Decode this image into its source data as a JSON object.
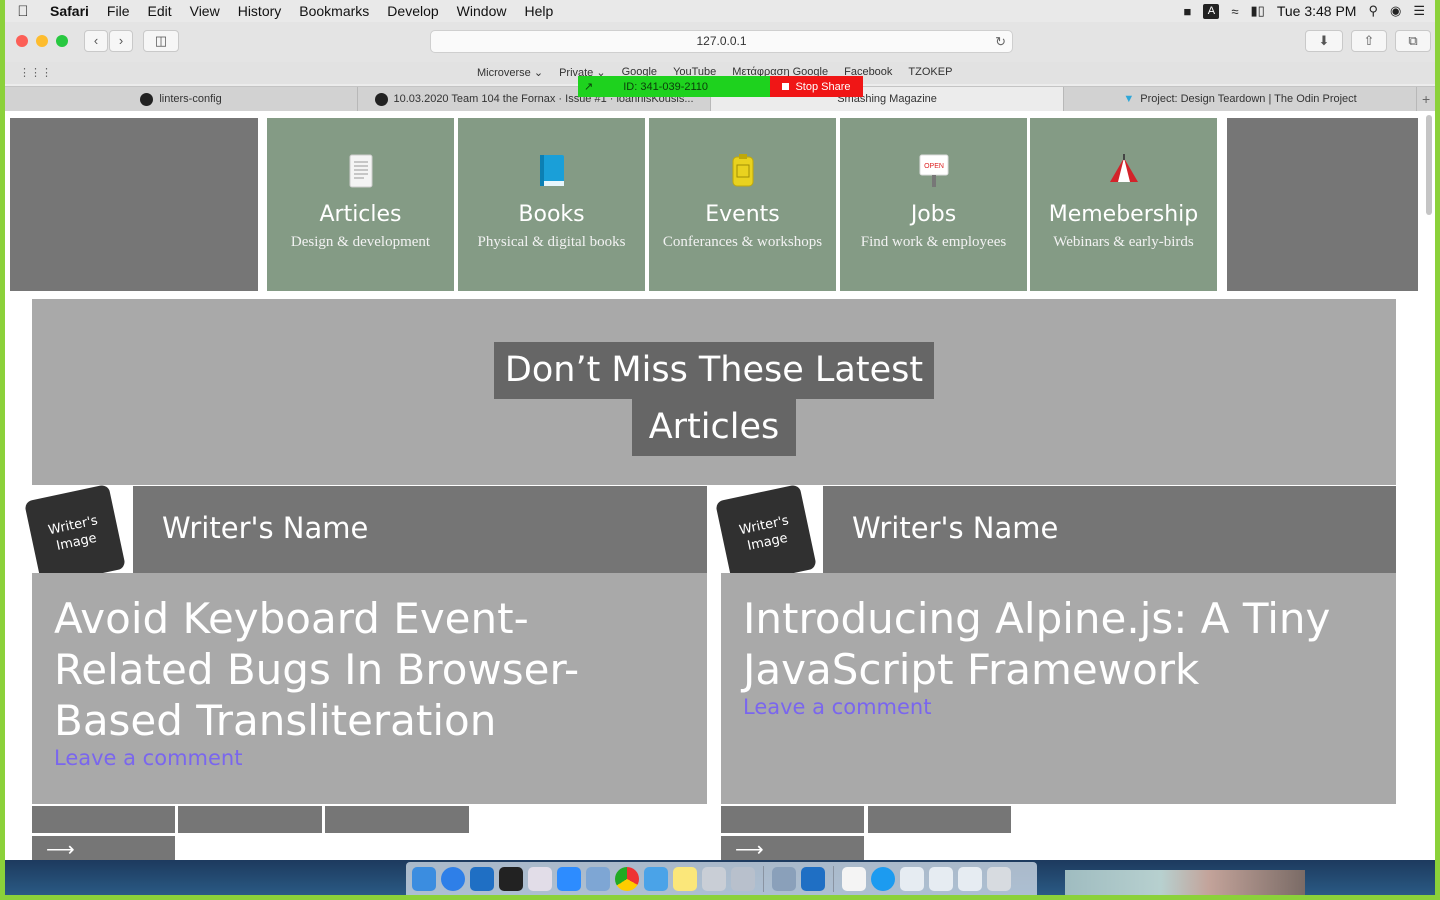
{
  "menubar": {
    "app": "Safari",
    "items": [
      "File",
      "Edit",
      "View",
      "History",
      "Bookmarks",
      "Develop",
      "Window",
      "Help"
    ],
    "input_source": "A",
    "clock": "Tue 3:48 PM"
  },
  "toolbar": {
    "address": "127.0.0.1"
  },
  "favorites": [
    "Microverse ⌄",
    "Private ⌄",
    "Google",
    "YouTube",
    "Μετάφραση Google",
    "Facebook",
    "TZOKEP"
  ],
  "share": {
    "id": "ID: 341-039-2110",
    "stop": "Stop Share"
  },
  "tabs": [
    {
      "label": "linters-config"
    },
    {
      "label": "10.03.2020 Team 104 the Fornax · Issue #1 · ioannisKousis..."
    },
    {
      "label": "Smashing Magazine"
    },
    {
      "label": "Project: Design Teardown | The Odin Project"
    }
  ],
  "nav_cards": [
    {
      "title": "Articles",
      "sub": "Design & development"
    },
    {
      "title": "Books",
      "sub": "Physical & digital books"
    },
    {
      "title": "Events",
      "sub": "Conferances & workshops"
    },
    {
      "title": "Jobs",
      "sub": "Find work & employees"
    },
    {
      "title": "Memebership",
      "sub": "Webinars & early-birds"
    }
  ],
  "hero": {
    "line1": "Don’t Miss These Latest",
    "line2": "Articles"
  },
  "articles": [
    {
      "badge": "Writer's Image",
      "writer": "Writer's Name",
      "title": "Avoid Keyboard Event-Related Bugs In Browser-Based Transliteration",
      "link": "Leave a comment"
    },
    {
      "badge": "Writer's Image",
      "writer": "Writer's Name",
      "title": "Introducing Alpine.js: A Tiny JavaScript Framework",
      "link": "Leave a comment"
    }
  ],
  "icons": {
    "open_sign": "OPEN"
  }
}
